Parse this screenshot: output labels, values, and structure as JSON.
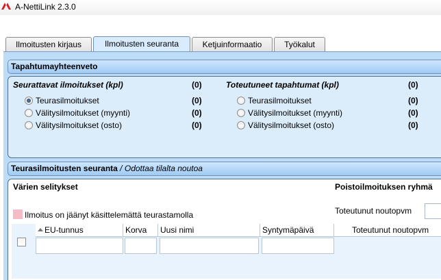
{
  "window": {
    "title": "A-NettiLink 2.3.0"
  },
  "tabs": [
    {
      "label": "Ilmoitusten kirjaus",
      "active": false
    },
    {
      "label": "Ilmoitusten seuranta",
      "active": true
    },
    {
      "label": "Ketjuinformaatio",
      "active": false
    },
    {
      "label": "Työkalut",
      "active": false
    }
  ],
  "summary": {
    "title": "Tapahtumayhteenveto",
    "tracked": {
      "header": "Seurattavat ilmoitukset (kpl)",
      "total": "(0)",
      "items": [
        {
          "label": "Teurasilmoitukset",
          "count": "(0)",
          "selected": true
        },
        {
          "label": "Välitysilmoitukset (myynti)",
          "count": "(0)",
          "selected": false
        },
        {
          "label": "Välitysilmoitukset (osto)",
          "count": "(0)",
          "selected": false
        }
      ]
    },
    "realized": {
      "header": "Toteutuneet tapahtumat (kpl)",
      "total": "(0)",
      "items": [
        {
          "label": "Teurasilmoitukset",
          "count": "(0)",
          "selected": false
        },
        {
          "label": "Välitysilmoitukset (myynti)",
          "count": "(0)",
          "selected": false
        },
        {
          "label": "Välitysilmoitukset (osto)",
          "count": "(0)",
          "selected": false
        }
      ]
    }
  },
  "tracking": {
    "title": "Teurasilmoitusten seuranta",
    "separator": "/",
    "subtitle": "Odottaa tilalta noutoa",
    "legend_title": "Värien selitykset",
    "legend_item": "Ilmoitus on jäänyt käsittelemättä teurastamolla",
    "legend_color": "#f5bcc8",
    "removal_group_title": "Poistoilmoituksen ryhmä",
    "realized_pickup_label": "Toteutunut noutopvm",
    "grid_columns": [
      "EU-tunnus",
      "Korva",
      "Uusi nimi",
      "Syntymäpäivä",
      "Toteutunut noutopvm"
    ]
  }
}
